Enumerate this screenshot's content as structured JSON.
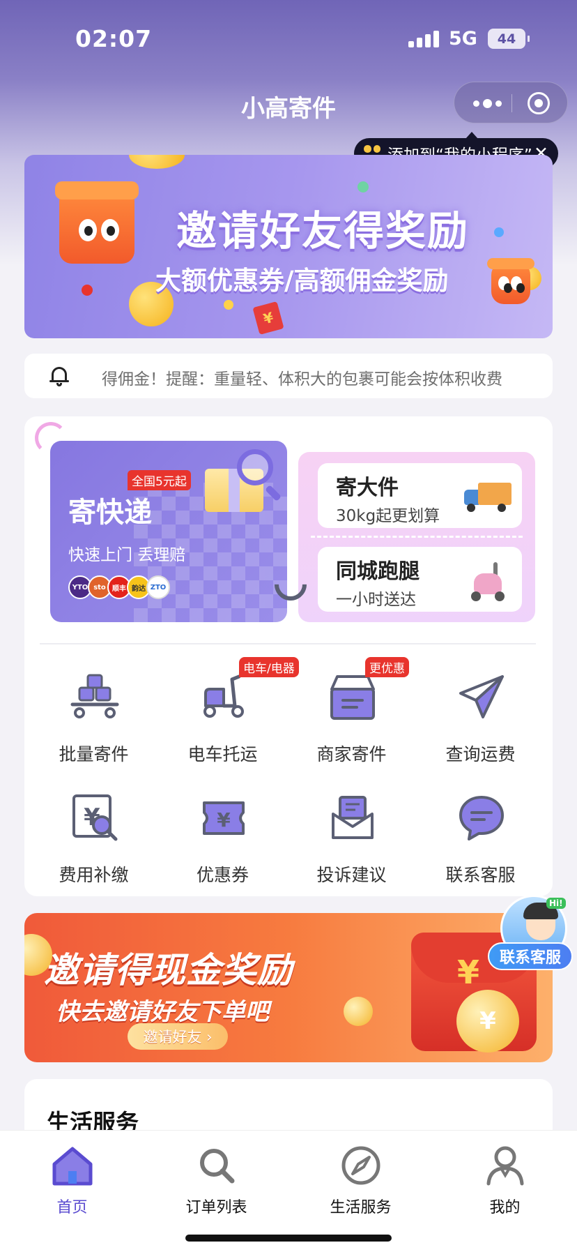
{
  "status_bar": {
    "time": "02:07",
    "network": "5G",
    "battery": "44"
  },
  "header": {
    "title": "小高寄件"
  },
  "mini_tip": {
    "text": "添加到“我的小程序”",
    "close": "✕"
  },
  "banner_top": {
    "title": "邀请好友得奖励",
    "subtitle": "大额优惠券/高额佣金奖励",
    "envelope_symbol": "¥"
  },
  "notice": {
    "text": "得佣金！提醒：重量轻、体积大的包裹可能会按体积收费"
  },
  "express": {
    "title": "寄快递",
    "badge": "全国5元起",
    "subtitle": "快速上门 丢理赔",
    "carrier_logos": [
      "YTO",
      "sto",
      "顺丰",
      "韵达",
      "ZTO"
    ]
  },
  "big_item": {
    "title": "寄大件",
    "subtitle": "30kg起更划算"
  },
  "errand": {
    "title": "同城跑腿",
    "subtitle": "一小时送达"
  },
  "grid": [
    {
      "label": "批量寄件",
      "icon": "stacked-boxes-icon",
      "badge": ""
    },
    {
      "label": "电车托运",
      "icon": "scooter-icon",
      "badge": "电车/电器"
    },
    {
      "label": "商家寄件",
      "icon": "merchant-box-icon",
      "badge": "更优惠"
    },
    {
      "label": "查询运费",
      "icon": "paper-plane-icon",
      "badge": ""
    },
    {
      "label": "费用补缴",
      "icon": "yen-search-icon",
      "badge": ""
    },
    {
      "label": "优惠券",
      "icon": "coupon-icon",
      "badge": ""
    },
    {
      "label": "投诉建议",
      "icon": "mail-icon",
      "badge": ""
    },
    {
      "label": "联系客服",
      "icon": "chat-icon",
      "badge": ""
    }
  ],
  "banner_cash": {
    "title": "邀请得现金奖励",
    "subtitle": "快去邀请好友下单吧",
    "button": "邀请好友 ›",
    "coin_symbol": "¥"
  },
  "float_service": {
    "label": "联系客服",
    "hi": "Hi!"
  },
  "life_section": {
    "title": "生活服务"
  },
  "tabbar": [
    {
      "label": "首页",
      "active": true
    },
    {
      "label": "订单列表",
      "active": false
    },
    {
      "label": "生活服务",
      "active": false
    },
    {
      "label": "我的",
      "active": false
    }
  ],
  "colors": {
    "primary": "#6c5ed6",
    "active_tab": "#5a4bd0",
    "badge_red": "#e8342d",
    "icon_dark": "#5b5f74",
    "icon_purple": "#8a7ee6"
  }
}
